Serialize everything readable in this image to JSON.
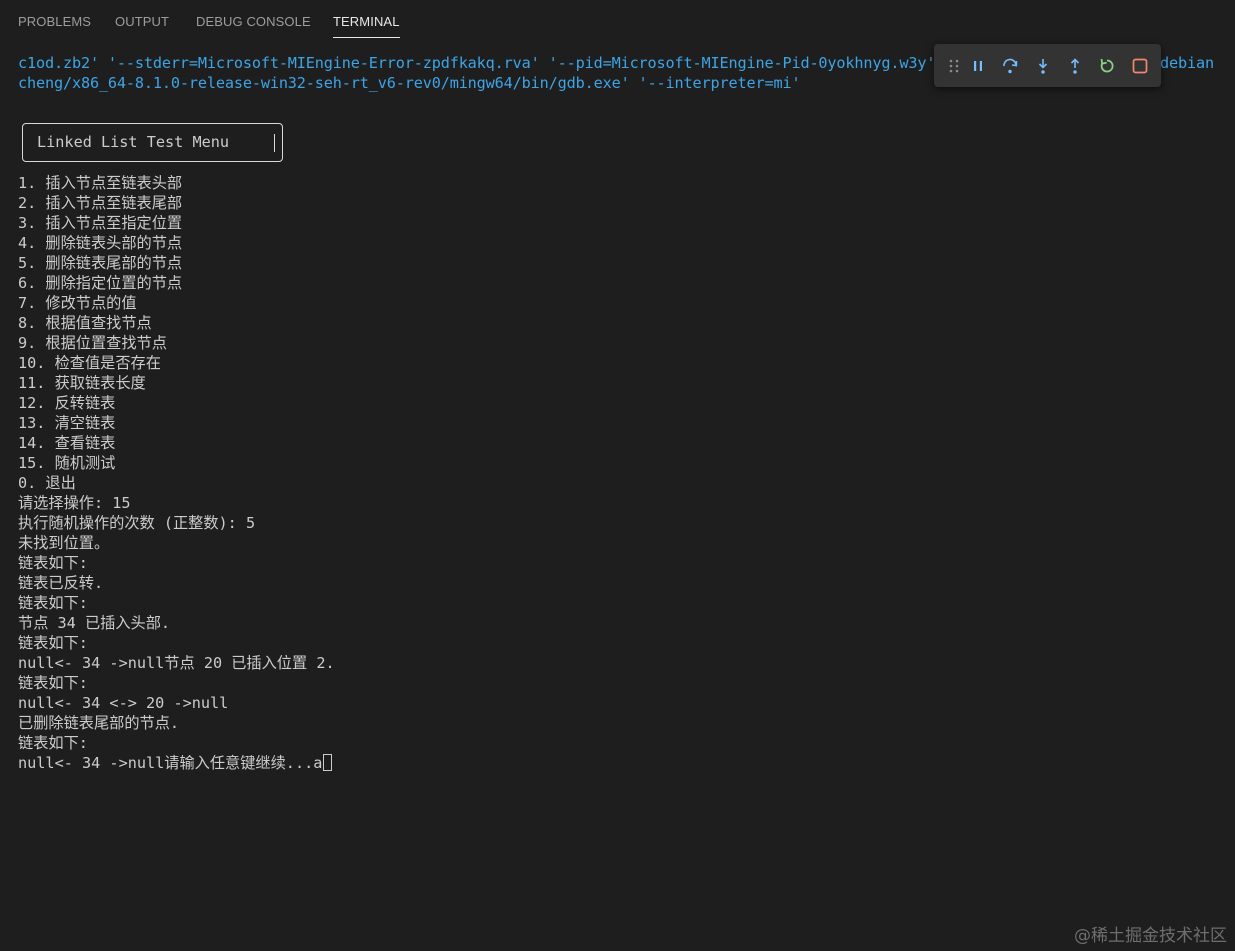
{
  "tabs": {
    "problems": "PROBLEMS",
    "output": "OUTPUT",
    "debug_console": "DEBUG CONSOLE",
    "terminal": "TERMINAL",
    "active": "terminal"
  },
  "command": {
    "line1": "c1od.zb2' '--stderr=Microsoft-MIEngine-Error-zpdfkakq.rva' '--pid=Microsoft-MIEngine-Pid-0yokhnyg.w3y'",
    "line1_tail": "debian",
    "line2": "cheng/x86_64-8.1.0-release-win32-seh-rt_v6-rev0/mingw64/bin/gdb.exe' '--interpreter=mi'"
  },
  "menu_title": "Linked List Test Menu",
  "output_lines": [
    "1. 插入节点至链表头部",
    "2. 插入节点至链表尾部",
    "3. 插入节点至指定位置",
    "4. 删除链表头部的节点",
    "5. 删除链表尾部的节点",
    "6. 删除指定位置的节点",
    "7. 修改节点的值",
    "8. 根据值查找节点",
    "9. 根据位置查找节点",
    "10. 检查值是否存在",
    "11. 获取链表长度",
    "12. 反转链表",
    "13. 清空链表",
    "14. 查看链表",
    "15. 随机测试",
    "0. 退出",
    "请选择操作: 15",
    "执行随机操作的次数 (正整数): 5",
    "未找到位置。",
    "链表如下:",
    "链表已反转.",
    "链表如下:",
    "节点 34 已插入头部.",
    "链表如下:",
    "null<- 34 ->null节点 20 已插入位置 2.",
    "链表如下:",
    "null<- 34 <-> 20 ->null",
    "已删除链表尾部的节点.",
    "链表如下:",
    "null<- 34 ->null请输入任意键继续...a"
  ],
  "debug_toolbar": {
    "buttons": [
      "drag-handle",
      "pause",
      "step-over",
      "step-into",
      "step-out",
      "restart",
      "stop"
    ],
    "colors": {
      "drag": "#8a8a8a",
      "pause": "#75beff",
      "step": "#75beff",
      "restart": "#89d185",
      "stop": "#f48771"
    }
  },
  "watermark": "@稀土掘金技术社区"
}
